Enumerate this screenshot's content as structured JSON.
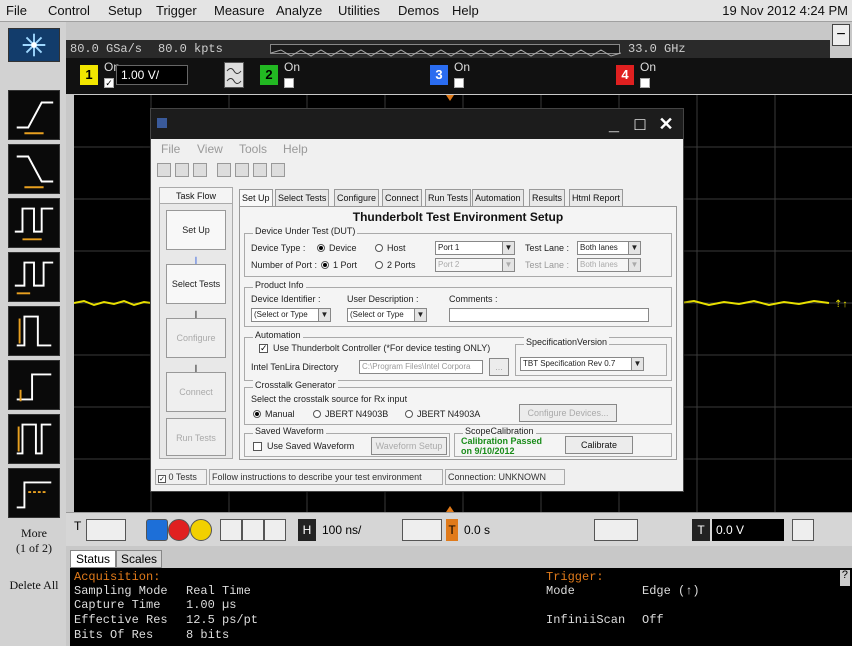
{
  "menubar": {
    "items": [
      "File",
      "Control",
      "Setup",
      "Trigger",
      "Measure",
      "Analyze",
      "Utilities",
      "Demos",
      "Help"
    ],
    "datetime": "19 Nov 2012  4:24 PM"
  },
  "topstrip": {
    "sample_rate": "80.0 GSa/s",
    "memory_depth": "80.0 kpts",
    "bandwidth": "33.0 GHz"
  },
  "channels": {
    "ch1": {
      "num": "1",
      "on_label": "On",
      "scale": "1.00 V/",
      "checked": "✓",
      "color": "#f2e600"
    },
    "ch2": {
      "num": "2",
      "on_label": "On",
      "color": "#22b822"
    },
    "ch3": {
      "num": "3",
      "on_label": "On",
      "color": "#2a6cf0"
    },
    "ch4": {
      "num": "4",
      "on_label": "On",
      "color": "#e02020"
    }
  },
  "sidebar": {
    "more_label": "More",
    "more_page": "(1 of 2)",
    "delete_all": "Delete All"
  },
  "dialog": {
    "menu": [
      "File",
      "View",
      "Tools",
      "Help"
    ],
    "taskflow": {
      "header": "Task Flow",
      "steps": [
        "Set Up",
        "Select Tests",
        "Configure",
        "Connect",
        "Run Tests"
      ]
    },
    "tabs": [
      "Set Up",
      "Select Tests",
      "Configure",
      "Connect",
      "Run Tests",
      "Automation",
      "Results",
      "Html Report"
    ],
    "panel_title": "Thunderbolt Test Environment Setup",
    "dut": {
      "group_label": "Device Under Test (DUT)",
      "device_type_label": "Device Type :",
      "device_option": "Device",
      "host_option": "Host",
      "port1_combo": "Port 1",
      "test_lane_label": "Test Lane :",
      "test_lane_value": "Both lanes",
      "num_port_label": "Number of Port :",
      "one_port": "1 Port",
      "two_ports": "2 Ports",
      "port2_combo": "Port 2",
      "test_lane2_label": "Test Lane :",
      "test_lane2_value": "Both lanes"
    },
    "product": {
      "group_label": "Product Info",
      "device_identifier": "Device Identifier :",
      "user_description": "User Description :",
      "comments": "Comments :",
      "select_type_1": "(Select or Type",
      "select_type_2": "(Select or Type"
    },
    "automation": {
      "group_label": "Automation",
      "use_controller": "Use Thunderbolt Controller (*For device testing ONLY)",
      "tenlira_label": "Intel TenLira Directory",
      "tenlira_path": "C:\\Program Files\\Intel Corpora",
      "browse": "...",
      "spec_label": "SpecificationVersion",
      "spec_value": "TBT Specification Rev 0.7"
    },
    "crosstalk": {
      "group_label": "Crosstalk Generator",
      "instruction": "Select the crosstalk source for Rx input",
      "manual": "Manual",
      "jbert1": "JBERT N4903B",
      "jbert2": "JBERT N4903A",
      "configure_devices": "Configure Devices..."
    },
    "saved_waveform": {
      "group_label": "Saved Waveform",
      "use_saved": "Use Saved Waveform",
      "waveform_setup": "Waveform Setup"
    },
    "scope_cal": {
      "group_label": "ScopeCalibration",
      "status": "Calibration Passed",
      "date": "on 9/10/2012",
      "calibrate": "Calibrate"
    },
    "statusbar": {
      "tests": "0 Tests",
      "message": "Follow instructions to describe your test environment",
      "connection": "Connection: UNKNOWN"
    }
  },
  "controlbar": {
    "timebase": "100 ns/",
    "delay": "0.0 s",
    "trigger_level": "0.0 V",
    "h_label": "H",
    "t_label": "T"
  },
  "status_tabs": [
    "Status",
    "Scales"
  ],
  "status_panel": {
    "acquisition_header": "Acquisition:",
    "rows": [
      {
        "label": "Sampling Mode",
        "value": "Real Time"
      },
      {
        "label": "Capture Time",
        "value": "1.00 µs"
      },
      {
        "label": "Effective Res",
        "value": "12.5 ps/pt"
      },
      {
        "label": "Bits Of Res",
        "value": "8 bits"
      }
    ],
    "trigger_header": "Trigger:",
    "trigger_rows": [
      {
        "label": "Mode",
        "value": "Edge (↑)"
      },
      {
        "label": "InfiniiScan",
        "value": "Off"
      }
    ]
  },
  "colors": {
    "trace": "#e8e000",
    "grid_bg": "#000000",
    "accent_orange": "#e07a1a"
  }
}
